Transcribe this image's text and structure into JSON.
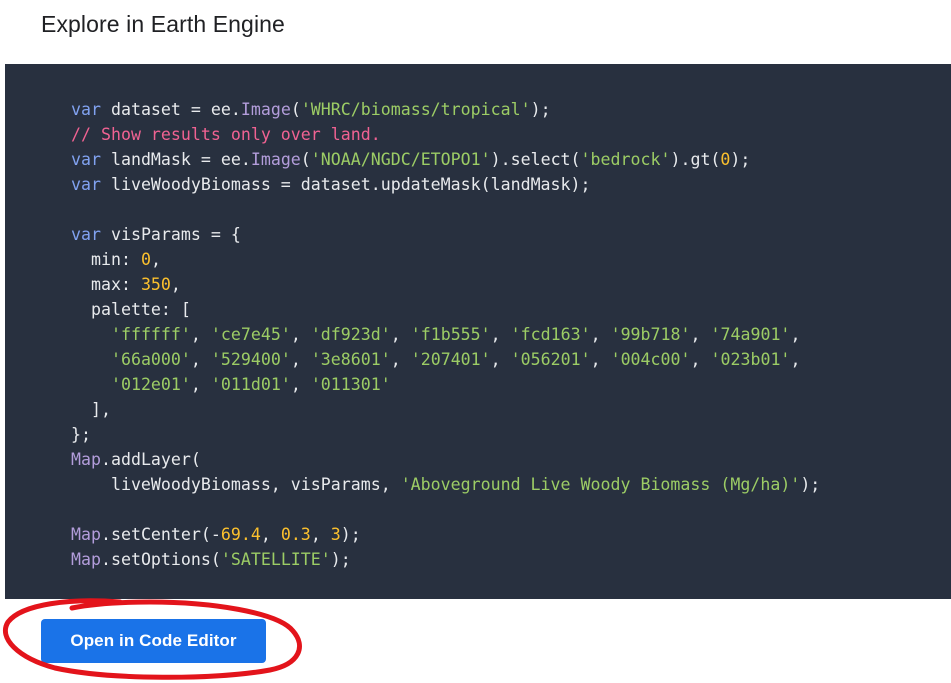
{
  "page": {
    "heading": "Explore in Earth Engine"
  },
  "code": {
    "language": "javascript",
    "lines": [
      [
        {
          "t": "kw",
          "v": "var"
        },
        {
          "t": "ident",
          "v": " dataset = ee."
        },
        {
          "t": "fn",
          "v": "Image"
        },
        {
          "t": "pun",
          "v": "("
        },
        {
          "t": "str",
          "v": "'WHRC/biomass/tropical'"
        },
        {
          "t": "pun",
          "v": ");"
        }
      ],
      [
        {
          "t": "cmt",
          "v": "// Show results only over land."
        }
      ],
      [
        {
          "t": "kw",
          "v": "var"
        },
        {
          "t": "ident",
          "v": " landMask = ee."
        },
        {
          "t": "fn",
          "v": "Image"
        },
        {
          "t": "pun",
          "v": "("
        },
        {
          "t": "str",
          "v": "'NOAA/NGDC/ETOPO1'"
        },
        {
          "t": "pun",
          "v": ").select("
        },
        {
          "t": "str",
          "v": "'bedrock'"
        },
        {
          "t": "pun",
          "v": ").gt("
        },
        {
          "t": "num",
          "v": "0"
        },
        {
          "t": "pun",
          "v": ");"
        }
      ],
      [
        {
          "t": "kw",
          "v": "var"
        },
        {
          "t": "ident",
          "v": " liveWoodyBiomass = dataset.updateMask(landMask);"
        }
      ],
      [],
      [
        {
          "t": "kw",
          "v": "var"
        },
        {
          "t": "ident",
          "v": " visParams = {"
        }
      ],
      [
        {
          "t": "ident",
          "v": "  min: "
        },
        {
          "t": "num",
          "v": "0"
        },
        {
          "t": "pun",
          "v": ","
        }
      ],
      [
        {
          "t": "ident",
          "v": "  max: "
        },
        {
          "t": "num",
          "v": "350"
        },
        {
          "t": "pun",
          "v": ","
        }
      ],
      [
        {
          "t": "ident",
          "v": "  palette: ["
        }
      ],
      [
        {
          "t": "ident",
          "v": "    "
        },
        {
          "t": "str",
          "v": "'ffffff'"
        },
        {
          "t": "pun",
          "v": ", "
        },
        {
          "t": "str",
          "v": "'ce7e45'"
        },
        {
          "t": "pun",
          "v": ", "
        },
        {
          "t": "str",
          "v": "'df923d'"
        },
        {
          "t": "pun",
          "v": ", "
        },
        {
          "t": "str",
          "v": "'f1b555'"
        },
        {
          "t": "pun",
          "v": ", "
        },
        {
          "t": "str",
          "v": "'fcd163'"
        },
        {
          "t": "pun",
          "v": ", "
        },
        {
          "t": "str",
          "v": "'99b718'"
        },
        {
          "t": "pun",
          "v": ", "
        },
        {
          "t": "str",
          "v": "'74a901'"
        },
        {
          "t": "pun",
          "v": ","
        }
      ],
      [
        {
          "t": "ident",
          "v": "    "
        },
        {
          "t": "str",
          "v": "'66a000'"
        },
        {
          "t": "pun",
          "v": ", "
        },
        {
          "t": "str",
          "v": "'529400'"
        },
        {
          "t": "pun",
          "v": ", "
        },
        {
          "t": "str",
          "v": "'3e8601'"
        },
        {
          "t": "pun",
          "v": ", "
        },
        {
          "t": "str",
          "v": "'207401'"
        },
        {
          "t": "pun",
          "v": ", "
        },
        {
          "t": "str",
          "v": "'056201'"
        },
        {
          "t": "pun",
          "v": ", "
        },
        {
          "t": "str",
          "v": "'004c00'"
        },
        {
          "t": "pun",
          "v": ", "
        },
        {
          "t": "str",
          "v": "'023b01'"
        },
        {
          "t": "pun",
          "v": ","
        }
      ],
      [
        {
          "t": "ident",
          "v": "    "
        },
        {
          "t": "str",
          "v": "'012e01'"
        },
        {
          "t": "pun",
          "v": ", "
        },
        {
          "t": "str",
          "v": "'011d01'"
        },
        {
          "t": "pun",
          "v": ", "
        },
        {
          "t": "str",
          "v": "'011301'"
        }
      ],
      [
        {
          "t": "ident",
          "v": "  ],"
        }
      ],
      [
        {
          "t": "ident",
          "v": "};"
        }
      ],
      [
        {
          "t": "fn",
          "v": "Map"
        },
        {
          "t": "ident",
          "v": ".addLayer("
        }
      ],
      [
        {
          "t": "ident",
          "v": "    liveWoodyBiomass, visParams, "
        },
        {
          "t": "str",
          "v": "'Aboveground Live Woody Biomass (Mg/ha)'"
        },
        {
          "t": "pun",
          "v": ");"
        }
      ],
      [],
      [
        {
          "t": "fn",
          "v": "Map"
        },
        {
          "t": "ident",
          "v": ".setCenter(-"
        },
        {
          "t": "num",
          "v": "69.4"
        },
        {
          "t": "pun",
          "v": ", "
        },
        {
          "t": "num",
          "v": "0.3"
        },
        {
          "t": "pun",
          "v": ", "
        },
        {
          "t": "num",
          "v": "3"
        },
        {
          "t": "pun",
          "v": ");"
        }
      ],
      [
        {
          "t": "fn",
          "v": "Map"
        },
        {
          "t": "ident",
          "v": ".setOptions("
        },
        {
          "t": "str",
          "v": "'SATELLITE'"
        },
        {
          "t": "pun",
          "v": ");"
        }
      ]
    ]
  },
  "actions": {
    "open_editor_label": "Open in Code Editor"
  },
  "colors": {
    "code_background": "#28303f",
    "button_background": "#1a73e8",
    "annotation_circle": "#e3141b"
  }
}
